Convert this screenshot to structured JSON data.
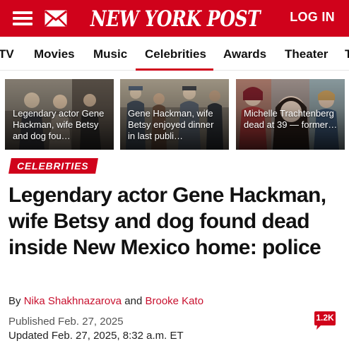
{
  "header": {
    "logo_text": "NEW YORK POST",
    "login_label": "LOG IN",
    "menu_icon": "hamburger-menu-icon",
    "mail_icon": "envelope-icon",
    "background_color": "#d0021b"
  },
  "nav": {
    "items": [
      "TV",
      "Movies",
      "Music",
      "Celebrities",
      "Awards",
      "Theater",
      "T"
    ],
    "active_index": 3,
    "active_color": "#d0021b"
  },
  "stories": [
    {
      "caption": "Legendary actor Gene Hackman, wife Betsy and dog fou…"
    },
    {
      "caption": "Gene Hackman, wife Betsy enjoyed dinner in last publi…"
    },
    {
      "caption": "Michelle Trachtenberg dead at 39 — former…"
    }
  ],
  "article": {
    "category": "CELEBRITIES",
    "headline": "Legendary actor Gene Hackman, wife Betsy and dog found dead inside New Mexico home: police",
    "byline_prefix": "By",
    "author_1": "Nika Shakhnazarova",
    "byline_and": "and",
    "author_2": "Brooke Kato",
    "published": "Published Feb. 27, 2025",
    "updated": "Updated Feb. 27, 2025, 8:32 a.m. ET",
    "comment_count": "1.2K",
    "comment_icon": "comment-bubble-icon",
    "accent_color": "#c8102e"
  }
}
